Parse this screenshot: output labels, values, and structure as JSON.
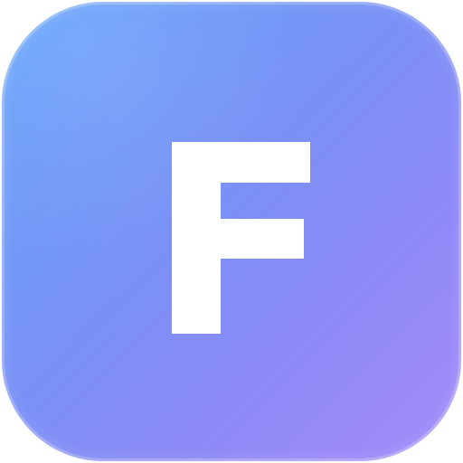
{
  "icon": {
    "letter": "F",
    "colors": {
      "gradient_start": "#64a4fb",
      "gradient_middle": "#8f89f7",
      "gradient_end": "#a58cf8",
      "letter": "#ffffff",
      "background": "#ffffff"
    }
  }
}
